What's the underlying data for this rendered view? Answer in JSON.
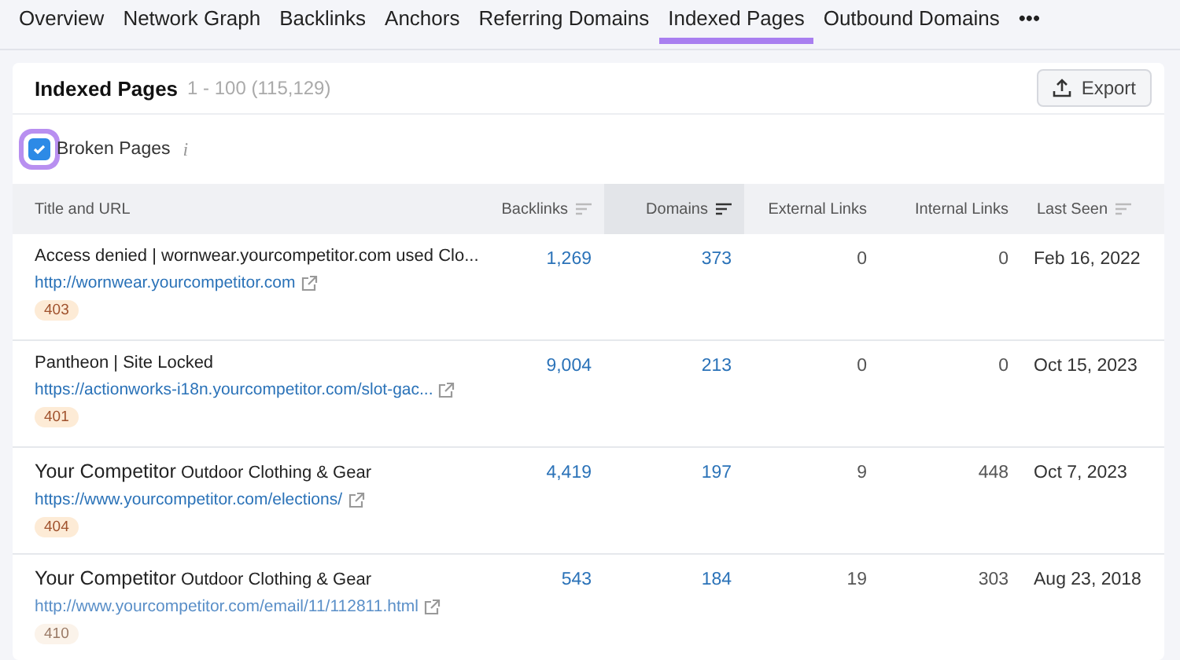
{
  "tabs": [
    {
      "label": "Overview",
      "selected": false
    },
    {
      "label": "Network Graph",
      "selected": false
    },
    {
      "label": "Backlinks",
      "selected": false
    },
    {
      "label": "Anchors",
      "selected": false
    },
    {
      "label": "Referring Domains",
      "selected": false
    },
    {
      "label": "Indexed Pages",
      "selected": true
    },
    {
      "label": "Outbound Domains",
      "selected": false
    },
    {
      "label": "•••",
      "selected": false
    }
  ],
  "panel": {
    "title": "Indexed Pages",
    "range": "1 - 100 (115,129)",
    "export_button": "Export",
    "filter": {
      "label": "Broken Pages",
      "checked": true,
      "info": "i"
    }
  },
  "table": {
    "columns": [
      {
        "label": "Title and URL",
        "sortable": false,
        "sorted": false
      },
      {
        "label": "Backlinks",
        "sortable": true,
        "sorted": false
      },
      {
        "label": "Domains",
        "sortable": true,
        "sorted": true
      },
      {
        "label": "External Links",
        "sortable": false,
        "sorted": false
      },
      {
        "label": "Internal Links",
        "sortable": false,
        "sorted": false
      },
      {
        "label": "Last Seen",
        "sortable": true,
        "sorted": false
      }
    ],
    "rows": [
      {
        "title": "Access denied | wornwear.yourcompetitor.com used Clo...",
        "url": "http://wornwear.yourcompetitor.com",
        "status": "403",
        "backlinks": "1,269",
        "domains": "373",
        "external_links": "0",
        "internal_links": "0",
        "last_seen": "Feb 16, 2022"
      },
      {
        "title": "Pantheon | Site Locked",
        "url": "https://actionworks-i18n.yourcompetitor.com/slot-gac...",
        "status": "401",
        "backlinks": "9,004",
        "domains": "213",
        "external_links": "0",
        "internal_links": "0",
        "last_seen": "Oct 15, 2023"
      },
      {
        "title": "Your Competitor",
        "subtitle": "Outdoor Clothing & Gear",
        "url": "https://www.yourcompetitor.com/elections/",
        "status": "404",
        "backlinks": "4,419",
        "domains": "197",
        "external_links": "9",
        "internal_links": "448",
        "last_seen": "Oct 7, 2023"
      },
      {
        "title": "Your Competitor",
        "subtitle": "Outdoor Clothing & Gear",
        "url": "http://www.yourcompetitor.com/email/11/112811.html",
        "status": "410",
        "backlinks": "543",
        "domains": "184",
        "external_links": "19",
        "internal_links": "303",
        "last_seen": "Aug 23, 2018"
      }
    ]
  }
}
